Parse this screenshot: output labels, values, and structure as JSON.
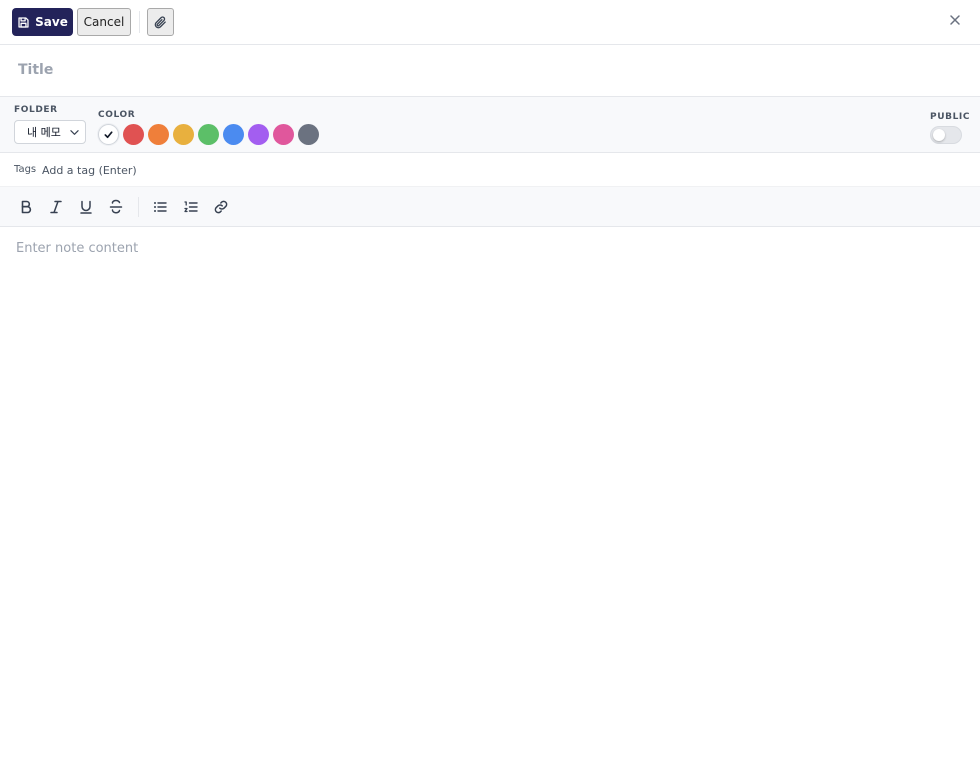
{
  "toolbar": {
    "save_label": "Save",
    "cancel_label": "Cancel",
    "icons": {
      "save": "floppy-disk-icon",
      "attach": "paperclip-icon",
      "close": "close-icon"
    }
  },
  "title": {
    "placeholder": "Title",
    "value": ""
  },
  "options": {
    "folder": {
      "label": "FOLDER",
      "selected": "내 메모"
    },
    "color": {
      "label": "COLOR",
      "selected_index": 0,
      "swatches": [
        "#ffffff",
        "#e05252",
        "#ef7f3a",
        "#e8b03e",
        "#5cbf68",
        "#4b8bf0",
        "#a35ef0",
        "#e0579c",
        "#6b7280"
      ]
    },
    "public": {
      "label": "PUBLIC",
      "enabled": false
    }
  },
  "tags": {
    "label": "Tags",
    "placeholder": "Add a tag (Enter)"
  },
  "formatting": {
    "buttons": [
      "bold",
      "italic",
      "underline",
      "strikethrough",
      "bullet-list",
      "numbered-list",
      "link"
    ]
  },
  "content": {
    "placeholder": "Enter note content",
    "value": ""
  },
  "colors": {
    "primary": "#23235a",
    "border": "#e5e7eb",
    "panel_bg": "#f8f9fb"
  }
}
